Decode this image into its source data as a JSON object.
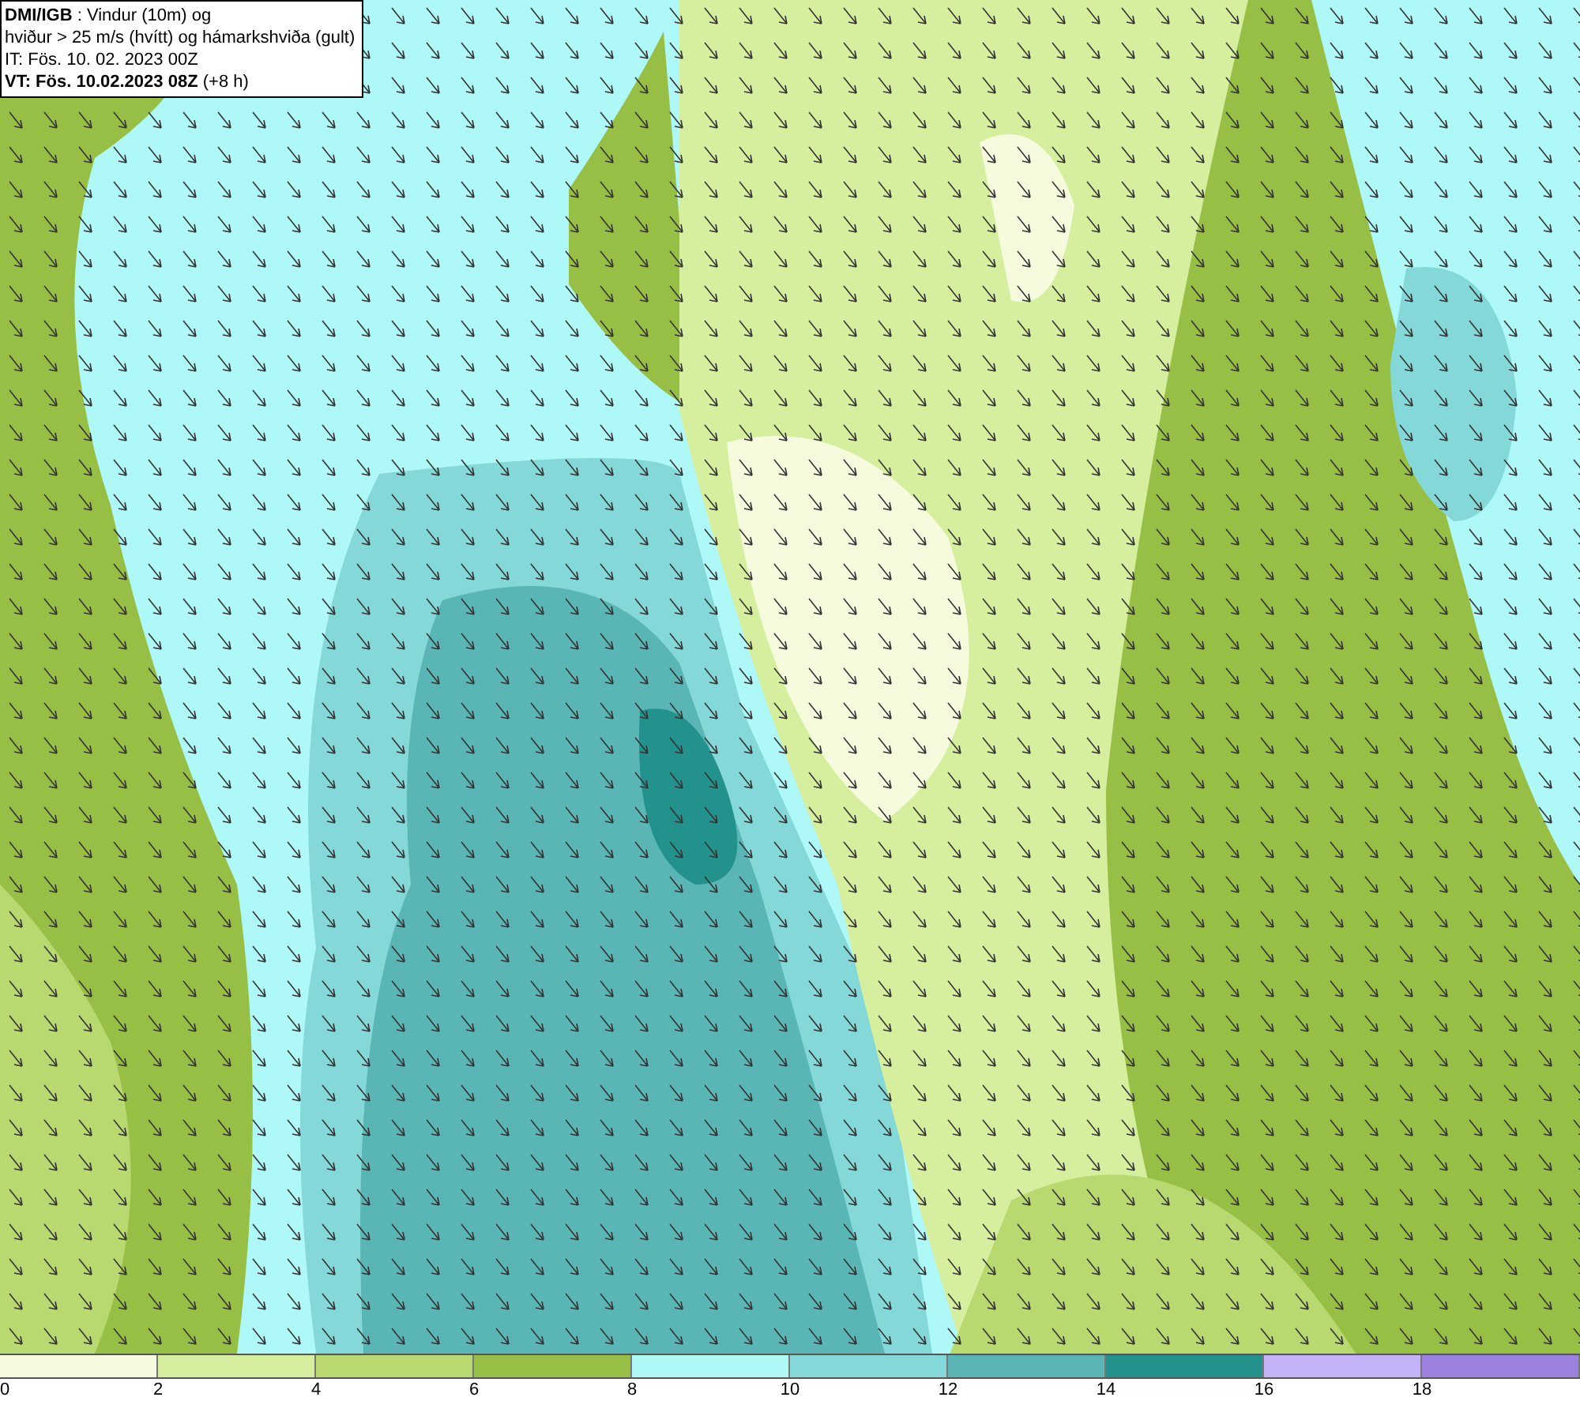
{
  "info_box": {
    "lines": [
      "**DMI/IGB** : Vindur (10m) og",
      "hviður > 25 m/s (hvítt) og hámarkshviða (gult)",
      "IT: Fös. 10. 02. 2023 00Z",
      "**VT: Fös. 10.02.2023 08Z** (+8 h)"
    ]
  },
  "legend": {
    "bins": [
      {
        "color": "#f5fbdc"
      },
      {
        "color": "#d6ef9e"
      },
      {
        "color": "#b8d970"
      },
      {
        "color": "#98bf45"
      },
      {
        "color": "#aef8f8"
      },
      {
        "color": "#84d8d8"
      },
      {
        "color": "#5ab5b5"
      },
      {
        "color": "#23918c"
      },
      {
        "color": "#c4b2f8"
      },
      {
        "color": "#9b80de"
      }
    ],
    "labels": [
      "0",
      "2",
      "4",
      "6",
      "8",
      "10",
      "12",
      "14",
      "16",
      "18"
    ]
  }
}
